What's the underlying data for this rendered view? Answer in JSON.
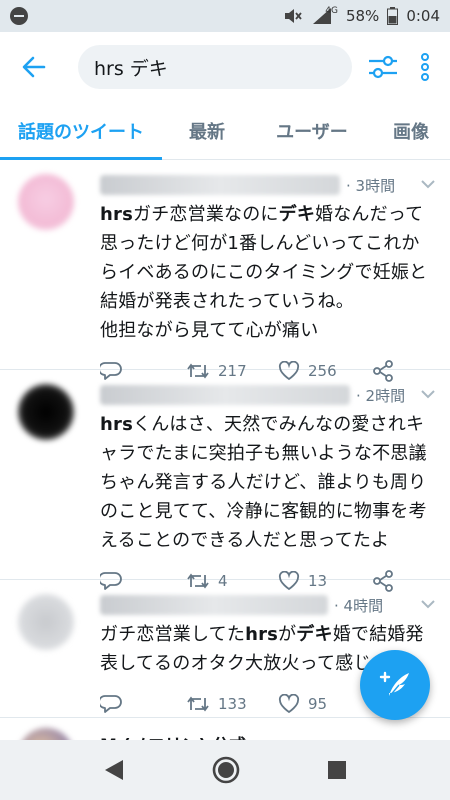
{
  "status": {
    "battery": "58%",
    "time": "0:04",
    "network": "4G"
  },
  "search": {
    "query": "hrs デキ"
  },
  "tabs": [
    "話題のツイート",
    "最新",
    "ユーザー",
    "画像"
  ],
  "tweets": [
    {
      "time": "· 3時間",
      "lines": [
        [
          {
            "b": "hrs"
          },
          {
            "t": "ガチ恋営業なのに"
          },
          {
            "b": "デキ"
          },
          {
            "t": "婚なんだって"
          }
        ],
        [
          {
            "t": "思ったけど何が1番しんどいってこれか"
          }
        ],
        [
          {
            "t": "らイベあるのにこのタイミングで妊娠と"
          }
        ],
        [
          {
            "t": "結婚が発表されたっていうね。"
          }
        ],
        [
          {
            "t": "他担ながら見てて心が痛い"
          }
        ]
      ],
      "retweets": "217",
      "likes": "256"
    },
    {
      "time": "· 2時間",
      "lines": [
        [
          {
            "b": "hrs"
          },
          {
            "t": "くんはさ、天然でみんなの愛されキ"
          }
        ],
        [
          {
            "t": "ャラでたまに突拍子も無いような不思議"
          }
        ],
        [
          {
            "t": "ちゃん発言する人だけど、誰よりも周り"
          }
        ],
        [
          {
            "t": "のこと見てて、冷静に客観的に物事を考"
          }
        ],
        [
          {
            "t": "えることのできる人だと思ってたよ"
          }
        ]
      ],
      "retweets": "4",
      "likes": "13"
    },
    {
      "time": "· 4時間",
      "lines": [
        [
          {
            "t": "ガチ恋営業してた"
          },
          {
            "b": "hrs"
          },
          {
            "t": "が"
          },
          {
            "b": "デキ"
          },
          {
            "t": "婚で結婚発"
          }
        ],
        [
          {
            "t": "表してるのオタク大放火って感じ"
          }
        ]
      ],
      "retweets": "133",
      "likes": "95"
    }
  ],
  "partial_tweet": {
    "name": "M (メエリン) 公式"
  },
  "colors": {
    "accent": "#1da1f2",
    "muted": "#657786",
    "text": "#14171a"
  }
}
